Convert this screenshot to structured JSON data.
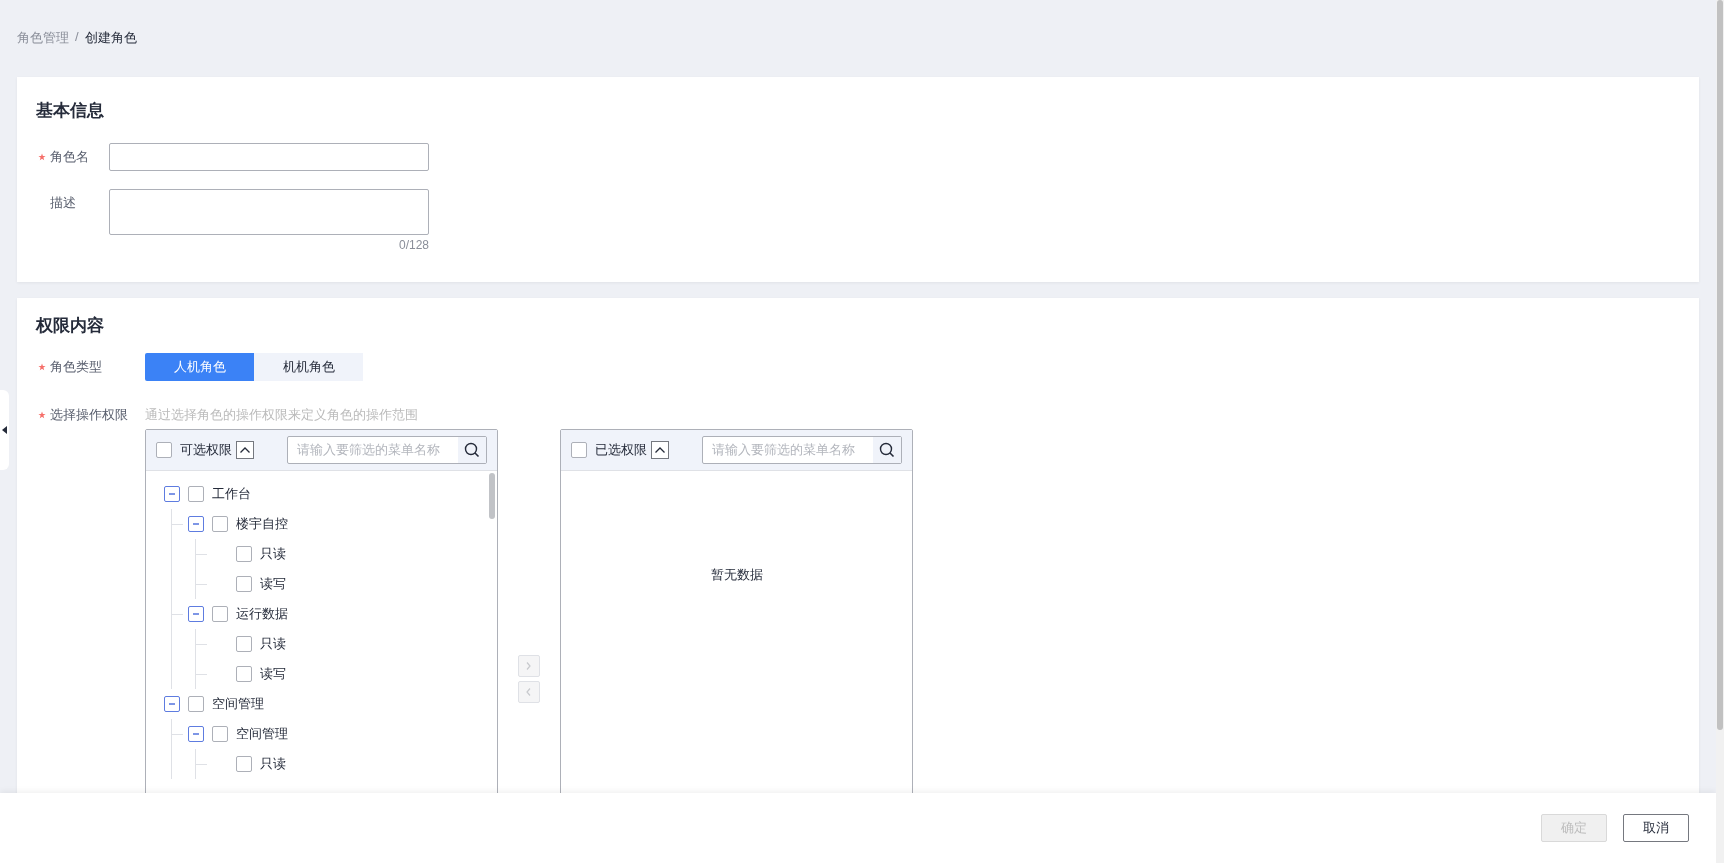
{
  "breadcrumb": {
    "separator": "/",
    "items": [
      {
        "label": "角色管理",
        "current": false
      },
      {
        "label": "创建角色",
        "current": true
      }
    ]
  },
  "basic_info": {
    "title": "基本信息",
    "fields": [
      {
        "kind": "input",
        "label": "角色名",
        "required": true
      },
      {
        "kind": "textarea",
        "label": "描述",
        "required": false,
        "counter": "0/128"
      }
    ]
  },
  "permissions": {
    "title": "权限内容",
    "role_type": {
      "label": "角色类型",
      "required": true,
      "options": [
        {
          "label": "人机角色",
          "selected": true
        },
        {
          "label": "机机角色",
          "selected": false
        }
      ]
    },
    "operation": {
      "label": "选择操作权限",
      "required": true,
      "hint": "通过选择角色的操作权限来定义角色的操作范围"
    },
    "source": {
      "title": "可选权限",
      "checked": false,
      "placeholder": "请输入要筛选的菜单名称",
      "tree": [
        {
          "label": "工作台",
          "checked": false,
          "expanded": true,
          "children": [
            {
              "label": "楼宇自控",
              "checked": false,
              "expanded": true,
              "children": [
                {
                  "label": "只读",
                  "checked": false
                },
                {
                  "label": "读写",
                  "checked": false
                }
              ]
            },
            {
              "label": "运行数据",
              "checked": false,
              "expanded": true,
              "children": [
                {
                  "label": "只读",
                  "checked": false
                },
                {
                  "label": "读写",
                  "checked": false
                }
              ]
            }
          ]
        },
        {
          "label": "空间管理",
          "checked": false,
          "expanded": true,
          "children": [
            {
              "label": "空间管理",
              "checked": false,
              "expanded": true,
              "children": [
                {
                  "label": "只读",
                  "checked": false
                }
              ]
            }
          ]
        }
      ]
    },
    "move_right": {
      "disabled": true
    },
    "move_left": {
      "disabled": true
    },
    "target": {
      "title": "已选权限",
      "checked": false,
      "placeholder": "请输入要筛选的菜单名称",
      "empty_text": "暂无数据"
    }
  },
  "footer": {
    "buttons": [
      {
        "label": "确定",
        "disabled": true
      },
      {
        "label": "取消",
        "disabled": false
      }
    ]
  }
}
